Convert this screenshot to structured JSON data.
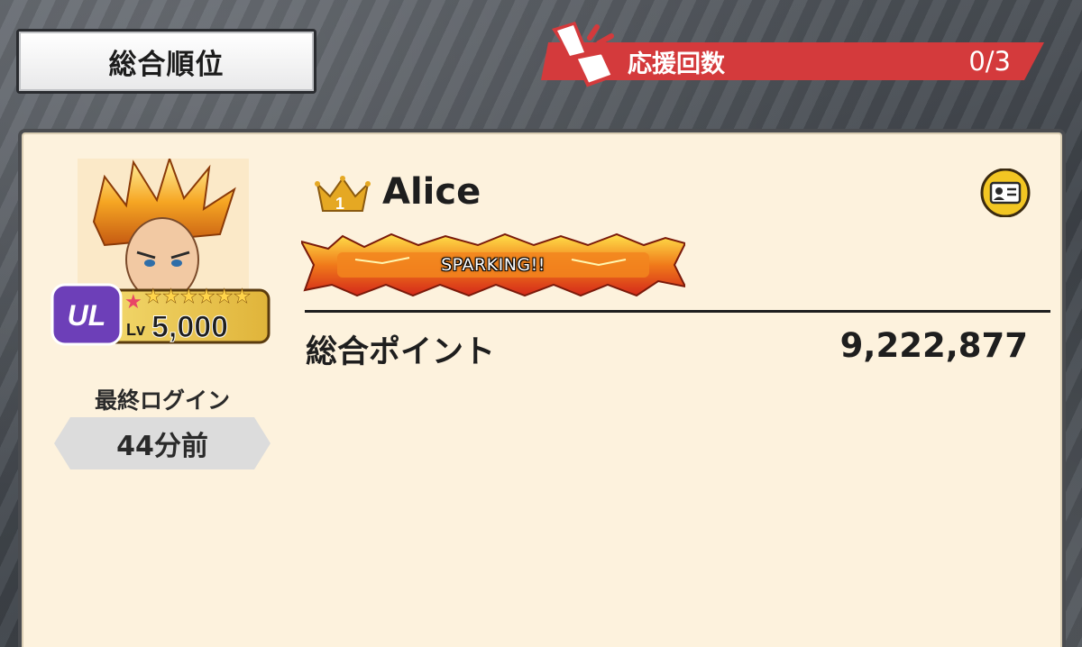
{
  "header": {
    "rank_tab_label": "総合順位",
    "support_label": "応援回数",
    "support_count": "0/3"
  },
  "player": {
    "name": "Alice",
    "rank_number": "1",
    "level_prefix": "Lv",
    "level_value": "5,000",
    "rarity_badge": "UL",
    "star_count": 7,
    "last_login_label": "最終ログイン",
    "last_login_value": "44分前",
    "title_banner": "SPARKING!!",
    "points_label": "総合ポイント",
    "points_value": "9,222,877"
  },
  "icons": {
    "support": "cheer-megaphone-icon",
    "crown": "rank-crown-icon",
    "profile": "profile-card-icon"
  },
  "colors": {
    "banner_red": "#d43a3c",
    "card_bg": "#fdf2dd",
    "crown_gold": "#e5a823"
  }
}
